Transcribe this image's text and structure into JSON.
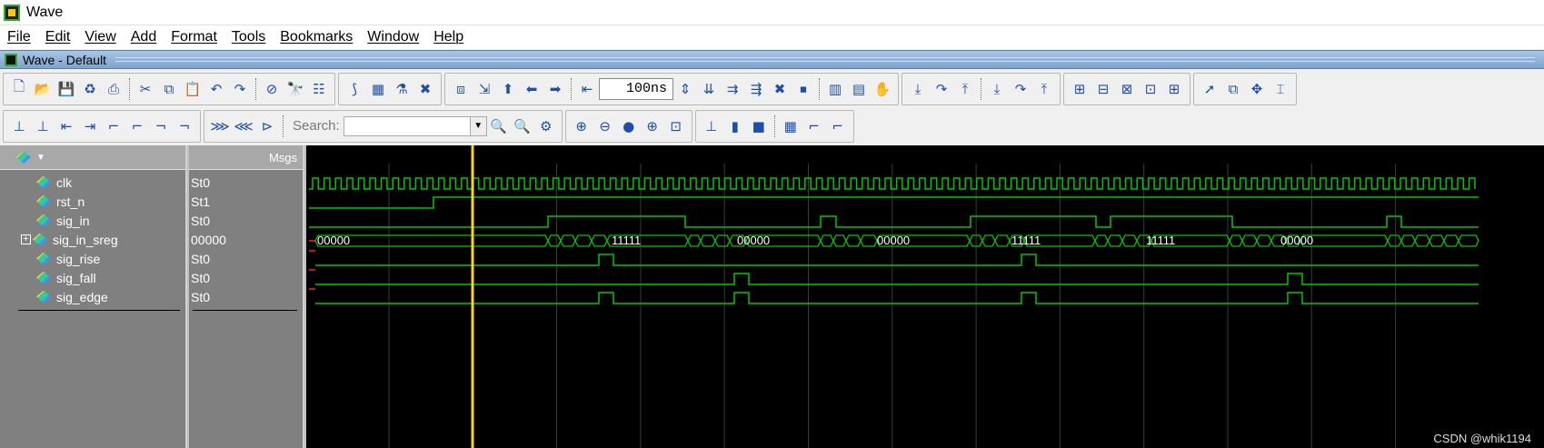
{
  "app": {
    "title": "Wave"
  },
  "menu": [
    "File",
    "Edit",
    "View",
    "Add",
    "Format",
    "Tools",
    "Bookmarks",
    "Window",
    "Help"
  ],
  "subwindow": {
    "title": "Wave - Default"
  },
  "toolbar": {
    "time_value": "100ns",
    "search_label": "Search:",
    "search_value": ""
  },
  "columns": {
    "msgs": "Msgs"
  },
  "signals": [
    {
      "name": "clk",
      "value": "St0",
      "expandable": false
    },
    {
      "name": "rst_n",
      "value": "St1",
      "expandable": false
    },
    {
      "name": "sig_in",
      "value": "St0",
      "expandable": false
    },
    {
      "name": "sig_in_sreg",
      "value": "00000",
      "expandable": true
    },
    {
      "name": "sig_rise",
      "value": "St0",
      "expandable": false
    },
    {
      "name": "sig_fall",
      "value": "St0",
      "expandable": false
    },
    {
      "name": "sig_edge",
      "value": "St0",
      "expandable": false
    }
  ],
  "bus_labels": [
    "00000",
    "11111",
    "00000",
    "00000",
    "11111",
    "11111",
    "00000"
  ],
  "watermark": "CSDN @whik1194",
  "colors": {
    "wave": "#00c800",
    "cursor": "#ffd21e",
    "background": "#000000",
    "grid": "#404040",
    "undefined": "#ff2020"
  }
}
